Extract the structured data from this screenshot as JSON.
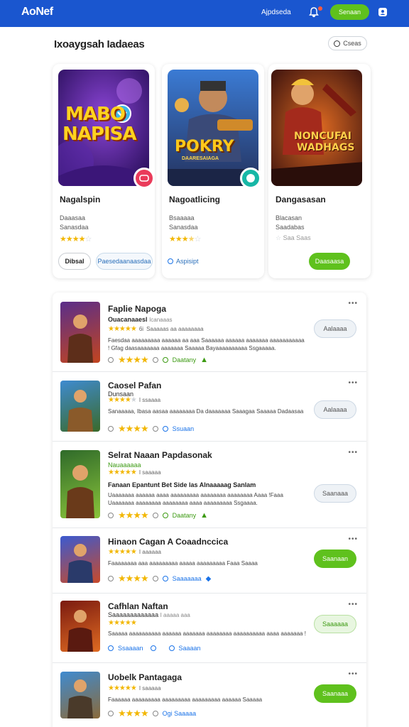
{
  "header": {
    "brand": "AoNef",
    "nav_link": "Ajpdseda",
    "cta_label": "Senaan"
  },
  "section": {
    "title": "Ixoaygsah Iadaeas",
    "pill_label": "Cseas"
  },
  "featured": [
    {
      "art_title_1": "MABO",
      "art_title_2": "NAPISA",
      "name": "Nagalspin",
      "meta1": "Daaasaa",
      "meta2": "Sanasdaa",
      "rating": 4,
      "btn1": "Dibsal",
      "btn2": "Paesedaanaasdaa"
    },
    {
      "art_title_1": "POKRY",
      "art_title_2": "DAARESAIAGA",
      "name": "Nagoatlicing",
      "meta1": "Bsaaaaa",
      "meta2": "Sanasdaa",
      "rating": 3.5,
      "btn1": "Aspisipt"
    },
    {
      "art_title_1": "NONCUFAI",
      "art_title_2": "WADHAGS",
      "name": "Dangasasan",
      "meta1": "Blacasan",
      "meta2": "Saadabas",
      "rating_text": "Saa Saas",
      "btn1": "Daasaasa"
    }
  ],
  "list": [
    {
      "title": "Faplie Napoga",
      "sub": "Ouacanaaesl",
      "sub_extra": "Icanaaas",
      "rating_num": "6i",
      "rating_tail": "Saaaaas aa aaaaaaaa",
      "desc": "Faesdaa aaaaaaaaa aaaaaa aa aaa Saaaaaa aaaaaa aaaaaaa aaaaaaaaaaa ! Gfag daasaaaaaaa aaaaaaa Saaaaa Bayaaaaaaaaaa Ssgaaaaa.",
      "foot_link": "Daatany",
      "action": "Aalaaaa"
    },
    {
      "title": "Caosel Pafan",
      "sub": "Dunsaan",
      "sub_extra": "I ssaaaa",
      "rating_num": "",
      "desc": "Sanaaaaa, Ibasa aasaa aaaaaaaa Da daaaaaaa Saaagaa Saaaaa Dadaasaa",
      "foot_link": "Ssuaan",
      "action": "Aalaaaa"
    },
    {
      "title": "Selrat Naaan Papdasonak",
      "sub": "Nauaaaaaa",
      "sub_extra": "I saaaaa",
      "desc_bold": "Fanaan  Epantunt  Bet Side las Alnaaaaag Sanlam",
      "desc": "Uaaaaaaa aaaaaa aaaa aaaaaaaaa aaaaaaaa aaaaaaaa Aaaa !Faaa Uaaaaaaa aaaaaaaa aaaaaaaa aaaa aaaaaaaaa Ssgaaaa.",
      "foot_link": "Daatany",
      "action": "Saanaaa"
    },
    {
      "title": "Hinaon Cagan A Coaadnccica",
      "rating_num": "I aaaaaa",
      "desc": "Faaaaaaaa aaa aaaaaaaaa aaaaa aaaaaaaaa Faaa Saaaa",
      "foot_link": "Saaaaaaa",
      "action": "Saanaan"
    },
    {
      "title": "Cafhlan Naftan",
      "sub": "Saaaaaaaaaaaaa",
      "sub_extra": "I aaaaa aaa",
      "desc": "Saaaaa aaaaaaaaaa aaaaaa aaaaaaa aaaaaaaa aaaaaaaaaa aaaa aaaaaaa !",
      "foot_link": "Ssaaaan",
      "foot_link2": "Saaaan",
      "action": "Saaaaaa"
    },
    {
      "title": "Uobelk Pantagaga",
      "rating_num": "I saaaaa",
      "desc": "Faaaaaa aaaaaaaaa aaaaaaaaa aaaaaaaaa aaaaaa  Saaaaa",
      "foot_link": "Ogi  Saaaaa",
      "action": "Saanaaa"
    }
  ],
  "colors": {
    "primary": "#1a56cf",
    "accent_green": "#5fc11d",
    "star": "#f2b705"
  }
}
